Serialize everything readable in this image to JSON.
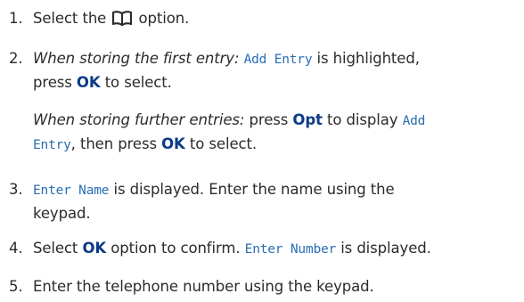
{
  "icons": {
    "phonebook": "phonebook-icon"
  },
  "colors": {
    "display_text": "#2a6db5",
    "key_text": "#0d3b88",
    "body_text": "#2b2b2b"
  },
  "steps": [
    {
      "number": "1.",
      "pre": "Select the",
      "post": "option."
    },
    {
      "number": "2.",
      "cond_first": "When storing the first entry:",
      "lcd_add_entry": "Add Entry",
      "mid": "is highlighted,",
      "line2_pre": "press",
      "ok": "OK",
      "line2_post": "to select.",
      "cond_further": "When storing further entries:",
      "press": "press",
      "opt": "Opt",
      "to_display": "to display",
      "lcd_add": "Add",
      "lcd_entry": "Entry",
      "then_press": ", then press",
      "ok2": "OK",
      "to_select": "to select."
    },
    {
      "number": "3.",
      "lcd_enter_name": "Enter Name",
      "post": "is displayed. Enter the name using the",
      "line2": "keypad."
    },
    {
      "number": "4.",
      "pre": "Select",
      "ok": "OK",
      "mid": "option to confirm.",
      "lcd_enter_number": "Enter Number",
      "post": "is displayed."
    },
    {
      "number": "5.",
      "text": "Enter the telephone number using the keypad."
    }
  ]
}
